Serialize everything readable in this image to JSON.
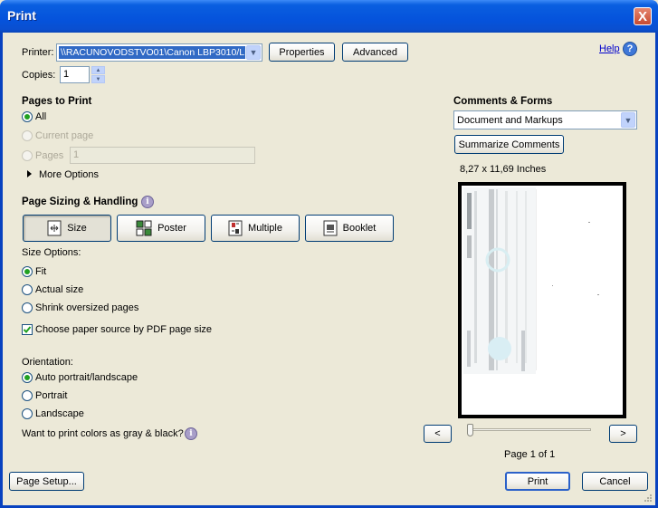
{
  "window": {
    "title": "Print",
    "close": "X"
  },
  "printer": {
    "label": "Printer:",
    "value": "\\\\RACUNOVODSTVO01\\Canon LBP3010/LB",
    "properties": "Properties",
    "advanced": "Advanced",
    "help": "Help"
  },
  "copies": {
    "label": "Copies:",
    "value": "1"
  },
  "pages_to_print": {
    "heading": "Pages to Print",
    "all": "All",
    "current": "Current page",
    "pages": "Pages",
    "pages_value": "1",
    "more": "More Options",
    "selected": "all"
  },
  "sizing": {
    "heading": "Page Sizing & Handling",
    "tabs": [
      "Size",
      "Poster",
      "Multiple",
      "Booklet"
    ],
    "active_tab": "Size",
    "size_options_label": "Size Options:",
    "fit": "Fit",
    "actual": "Actual size",
    "shrink": "Shrink oversized pages",
    "selected": "fit",
    "paper_source": "Choose paper source by PDF page size",
    "paper_source_checked": true
  },
  "orientation": {
    "label": "Orientation:",
    "auto": "Auto portrait/landscape",
    "portrait": "Portrait",
    "landscape": "Landscape",
    "selected": "auto"
  },
  "gray_question": "Want to print colors as gray & black?",
  "comments": {
    "heading": "Comments & Forms",
    "value": "Document and Markups",
    "summarize": "Summarize Comments"
  },
  "preview": {
    "size_text": "8,27 x 11,69 Inches",
    "prev": "<",
    "next": ">",
    "page_info": "Page 1 of 1"
  },
  "footer": {
    "page_setup": "Page Setup...",
    "print": "Print",
    "cancel": "Cancel"
  },
  "colors": {
    "title_bar": "#0553dc",
    "dialog_bg": "#ece9d8",
    "radio_on": "#21a121"
  }
}
